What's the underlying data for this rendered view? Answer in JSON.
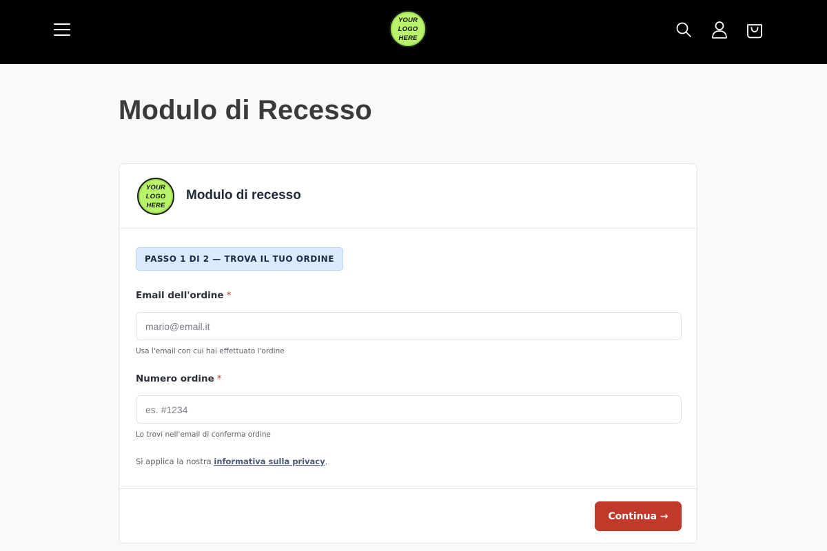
{
  "header": {
    "menu_icon": "hamburger-menu-icon",
    "logo_lines": [
      "YOUR",
      "LOGO",
      "HERE"
    ],
    "search_icon": "search-icon",
    "account_icon": "user-icon",
    "cart_icon": "shopping-bag-icon"
  },
  "page": {
    "title": "Modulo di Recesso"
  },
  "card": {
    "logo_lines": [
      "YOUR",
      "LOGO",
      "HERE"
    ],
    "title": "Modulo di recesso",
    "step": "PASSO 1 DI 2 — TROVA IL TUO ORDINE",
    "email": {
      "label": "Email dell'ordine",
      "required_mark": "*",
      "value": "",
      "placeholder": "mario@email.it",
      "hint": "Usa l'email con cui hai effettuato l'ordine"
    },
    "order": {
      "label": "Numero ordine",
      "required_mark": "*",
      "value": "",
      "placeholder": "es. #1234",
      "hint": "Lo trovi nell'email di conferma ordine"
    },
    "privacy": {
      "prefix": "Si applica la nostra ",
      "link": "informativa sulla privacy",
      "suffix": "."
    },
    "continue_label": "Continua →"
  },
  "colors": {
    "header_bg": "#000000",
    "accent": "#c0392b",
    "logo_green": "#b9f26b",
    "step_badge_bg": "#dbeafe"
  }
}
